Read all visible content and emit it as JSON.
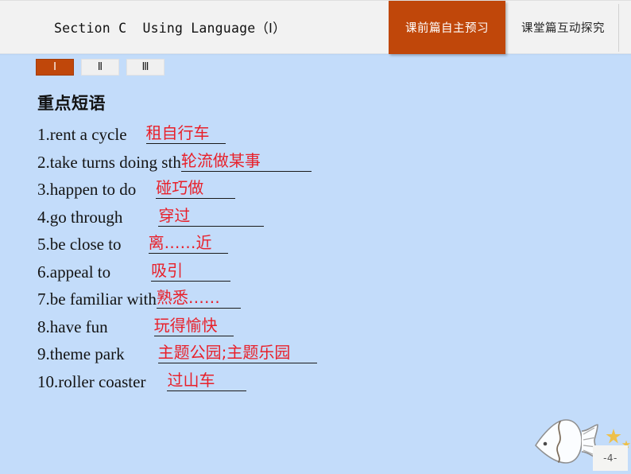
{
  "header": {
    "title": "Section C  Using Language（Ⅰ）",
    "tabs": [
      {
        "label": "课前篇自主预习",
        "active": true
      },
      {
        "label": "课堂篇互动探究",
        "active": false
      }
    ]
  },
  "numeral_tabs": [
    {
      "label": "Ⅰ",
      "active": true
    },
    {
      "label": "Ⅱ",
      "active": false
    },
    {
      "label": "Ⅲ",
      "active": false
    }
  ],
  "content": {
    "heading": "重点短语",
    "phrases": [
      {
        "num": "1.",
        "english": "rent a cycle",
        "chinese": "租自行车",
        "blank_width": 100,
        "gap": 24
      },
      {
        "num": "2.",
        "english": "take turns doing sth",
        "chinese": "轮流做某事",
        "blank_width": 164,
        "gap": 0
      },
      {
        "num": "3.",
        "english": "happen to do",
        "chinese": "碰巧做",
        "blank_width": 100,
        "gap": 25
      },
      {
        "num": "4.",
        "english": "go through",
        "chinese": "穿过",
        "blank_width": 133,
        "gap": 45
      },
      {
        "num": "5.",
        "english": "be close to",
        "chinese": "离……近",
        "blank_width": 100,
        "gap": 34
      },
      {
        "num": "6.",
        "english": "appeal to",
        "chinese": "吸引",
        "blank_width": 100,
        "gap": 51
      },
      {
        "num": "7.",
        "english": "be familiar with",
        "chinese": "熟悉……",
        "blank_width": 106,
        "gap": 0
      },
      {
        "num": "8.",
        "english": "have fun",
        "chinese": "玩得愉快",
        "blank_width": 100,
        "gap": 58
      },
      {
        "num": "9.",
        "english": "theme park",
        "chinese": "主题公园;主题乐园",
        "blank_width": 200,
        "gap": 42
      },
      {
        "num": "10.",
        "english": "roller coaster",
        "chinese": "过山车",
        "blank_width": 100,
        "gap": 27
      }
    ]
  },
  "footer": {
    "page_number": "-4-"
  },
  "decorations": {
    "fish": "fish-icon",
    "star": "star-icon"
  },
  "colors": {
    "background": "#c3dcfa",
    "header_bg": "#f2f2f2",
    "accent_orange": "#c0470a",
    "answer_red": "#e8202a"
  }
}
